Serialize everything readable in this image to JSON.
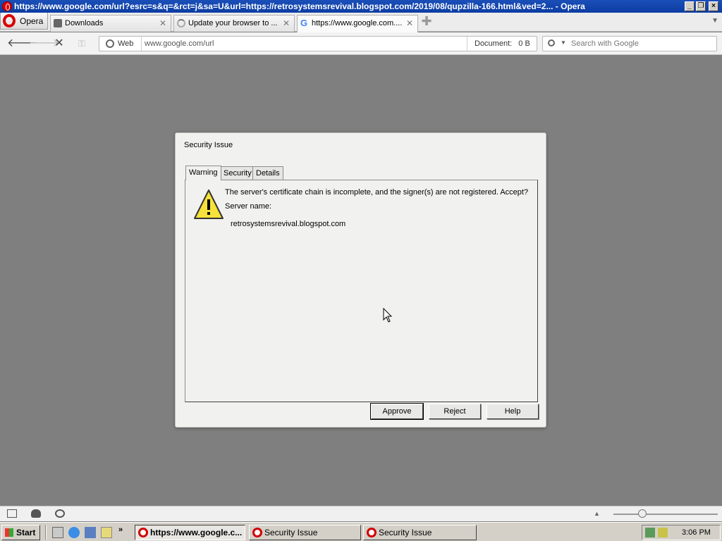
{
  "window": {
    "title": "https://www.google.com/url?esrc=s&q=&rct=j&sa=U&url=https://retrosystemsrevival.blogspot.com/2019/08/qupzilla-166.html&ved=2... - Opera"
  },
  "tabstrip": {
    "menu_label": "Opera",
    "tabs": [
      {
        "label": "Downloads",
        "icon": "download-icon"
      },
      {
        "label": "Update your browser to ...",
        "icon": "loading-icon"
      },
      {
        "label": "https://www.google.com....",
        "icon": "google-icon"
      }
    ]
  },
  "toolbar": {
    "web_label": "Web",
    "address_value": "www.google.com/url",
    "document_label": "Document:",
    "document_size": "0 B",
    "search_placeholder": "Search with Google"
  },
  "dialog": {
    "title": "Security Issue",
    "tabs": [
      "Warning",
      "Security",
      "Details"
    ],
    "message": "The server's certificate chain is incomplete, and the signer(s) are not registered. Accept?",
    "server_label": "Server name:",
    "server_value": "retrosystemsrevival.blogspot.com",
    "buttons": {
      "approve": "Approve",
      "reject": "Reject",
      "help": "Help"
    }
  },
  "taskbar": {
    "start_label": "Start",
    "quicklaunch_more": "»",
    "tasks": [
      "https://www.google.c...",
      "Security Issue",
      "Security Issue"
    ],
    "clock": "3:06 PM"
  },
  "colors": {
    "titlebar": "#0c3da3",
    "desktop_bg": "#7f7f7f",
    "dialog_bg": "#f1f1ef",
    "warning_yellow": "#f7e23a",
    "opera_red": "#d70000"
  }
}
